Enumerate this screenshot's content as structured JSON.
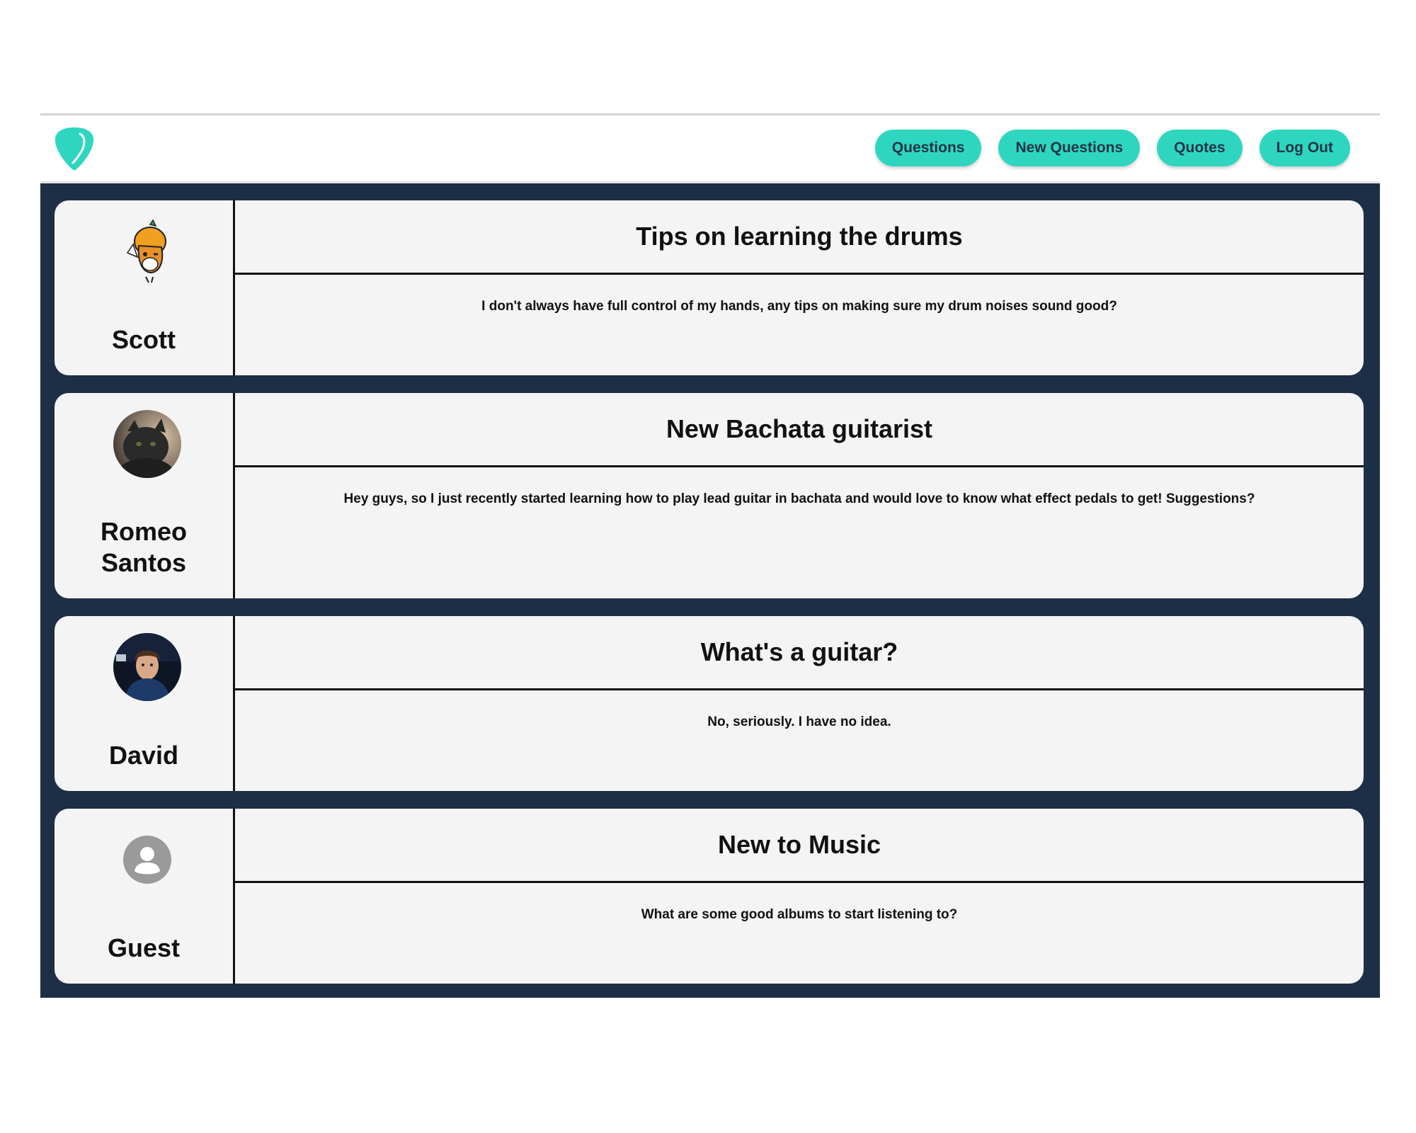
{
  "nav": {
    "logo_icon": "guitar-pick-logo",
    "buttons": [
      "Questions",
      "New Questions",
      "Quotes",
      "Log Out"
    ]
  },
  "colors": {
    "accent": "#2ed6c0",
    "feed_background": "#1d2f46",
    "card_background": "#f4f4f4"
  },
  "posts": [
    {
      "author": "Scott",
      "avatar_icon": "cartoon-fox-avatar",
      "title": "Tips on learning the drums",
      "body": "I don't always have full control of my hands, any tips on making sure my drum noises sound good?"
    },
    {
      "author": "Romeo Santos",
      "avatar_icon": "cat-photo-avatar",
      "title": "New Bachata guitarist",
      "body": "Hey guys, so I just recently started learning how to play lead guitar in bachata and would love to know what effect pedals to get! Suggestions?"
    },
    {
      "author": "David",
      "avatar_icon": "person-photo-avatar",
      "title": "What's a guitar?",
      "body": "No, seriously. I have no idea."
    },
    {
      "author": "Guest",
      "avatar_icon": "default-user-icon",
      "title": "New to Music",
      "body": "What are some good albums to start listening to?"
    }
  ]
}
